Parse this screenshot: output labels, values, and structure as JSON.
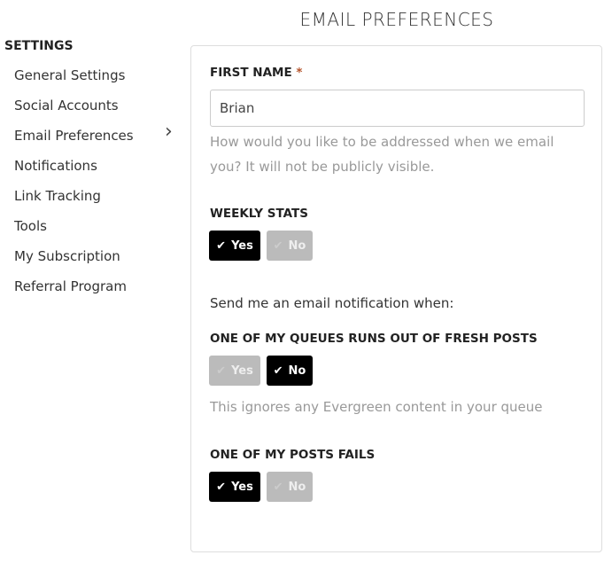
{
  "page_title": "EMAIL PREFERENCES",
  "sidebar": {
    "heading": "SETTINGS",
    "items": [
      {
        "label": "General Settings"
      },
      {
        "label": "Social Accounts"
      },
      {
        "label": "Email Preferences",
        "active": true
      },
      {
        "label": "Notifications"
      },
      {
        "label": "Link Tracking"
      },
      {
        "label": "Tools"
      },
      {
        "label": "My Subscription"
      },
      {
        "label": "Referral Program"
      }
    ]
  },
  "form": {
    "first_name": {
      "label": "FIRST NAME",
      "required_mark": "*",
      "value": "Brian",
      "help": "How would you like to be addressed when we email you? It will not be publicly visible."
    },
    "weekly_stats": {
      "label": "WEEKLY STATS",
      "yes": "Yes",
      "no": "No",
      "selected": "Yes"
    },
    "notify_intro": "Send me an email notification when:",
    "queue_empty": {
      "label": "ONE OF MY QUEUES RUNS OUT OF FRESH POSTS",
      "yes": "Yes",
      "no": "No",
      "selected": "No",
      "help": "This ignores any Evergreen content in your queue"
    },
    "post_fails": {
      "label": "ONE OF MY POSTS FAILS",
      "yes": "Yes",
      "no": "No",
      "selected": "Yes"
    }
  },
  "icons": {
    "check": "check-icon",
    "chevron": "chevron-right-icon"
  }
}
